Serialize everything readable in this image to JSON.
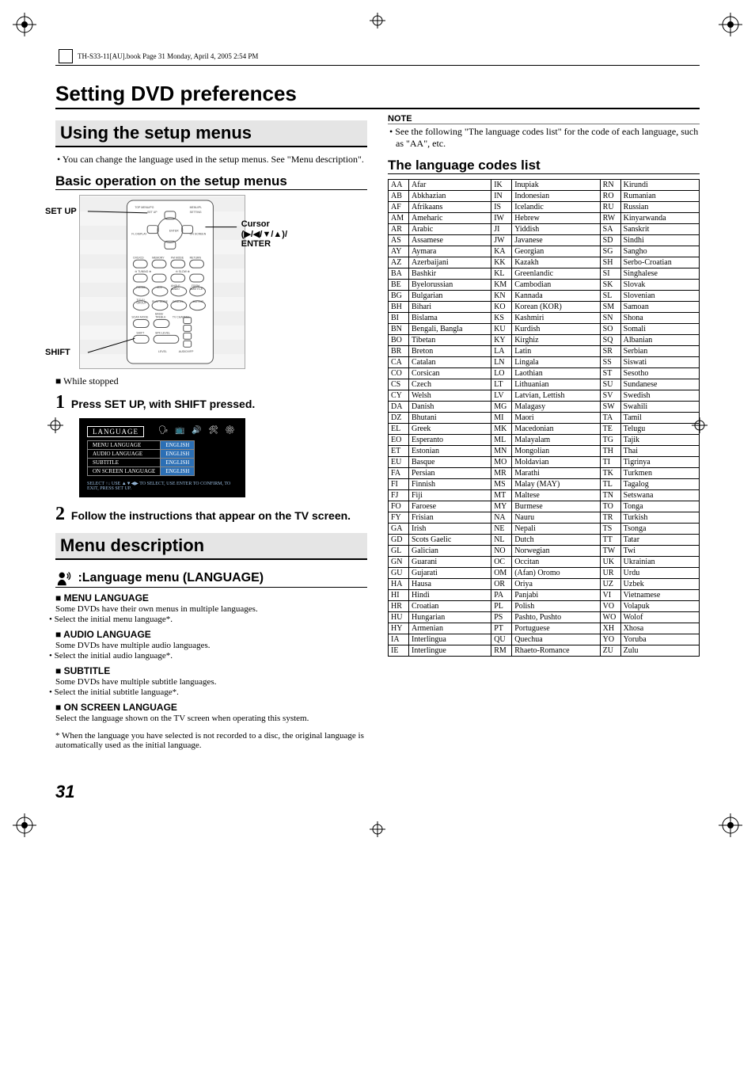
{
  "header_note": "TH-S33-11[AU].book  Page 31  Monday, April 4, 2005  2:54 PM",
  "doc_title": "Setting DVD preferences",
  "left": {
    "using_title": "Using the setup menus",
    "using_bullet": "You can change the language used in the setup menus. See \"Menu description\".",
    "basic_title": "Basic operation on the setup menus",
    "remote": {
      "setup": "SET UP",
      "shift": "SHIFT",
      "cursor": "Cursor",
      "cursor2": "(▶/◀/▼/▲)/",
      "enter": "ENTER",
      "btns": [
        "TOP MENU/PG",
        "MENU/PL",
        "SET UP",
        "SETTING",
        "FL DISPLAY",
        "ON SCREEN",
        "DVD/CD",
        "MEMORY",
        "FM MODE",
        "RETURN",
        "TUNING",
        "SLOW",
        "FM/AM",
        "AUX",
        "ANGLE AUDIO",
        "ZOOM SUBTITLE",
        "TITLE/ GROUP",
        "PLAY MODE",
        "CANCEL",
        "MUTING",
        "SCAN MODE",
        "BASS/ TREBLE",
        "TV CHANNEL",
        "SHIFT",
        "SPK-LEVEL",
        "LEVEL",
        "AUDIO/VFP"
      ]
    },
    "while_stopped": "While stopped",
    "step1": "Press SET UP, with SHIFT pressed.",
    "tv": {
      "title": "LANGUAGE",
      "rows": [
        [
          "MENU LANGUAGE",
          "ENGLISH"
        ],
        [
          "AUDIO LANGUAGE",
          "ENGLISH"
        ],
        [
          "SUBTITLE",
          "ENGLISH"
        ],
        [
          "ON SCREEN LANGUAGE",
          "ENGLISH"
        ]
      ],
      "hint": "SELECT ↑↓  USE ▲▼◀▶ TO SELECT, USE ENTER TO CONFIRM, TO EXIT, PRESS SET UP."
    },
    "step2": "Follow the instructions that appear on the TV screen.",
    "menu_desc_title": "Menu description",
    "lang_menu_title": ":Language menu (LANGUAGE)",
    "para": [
      {
        "label": "MENU LANGUAGE",
        "l1": "Some DVDs have their own menus in multiple languages.",
        "l2": "Select the initial menu language*."
      },
      {
        "label": "AUDIO LANGUAGE",
        "l1": "Some DVDs have multiple audio languages.",
        "l2": "Select the initial audio language*."
      },
      {
        "label": "SUBTITLE",
        "l1": "Some DVDs have multiple subtitle languages.",
        "l2": "Select the initial subtitle language*."
      },
      {
        "label": "ON SCREEN LANGUAGE",
        "l1": "Select the language shown on the TV screen when operating this system.",
        "l2": ""
      }
    ],
    "foot": "* When the language you have selected is not recorded to a disc, the original language is automatically used as the initial language.",
    "pagenum": "31"
  },
  "right": {
    "note_head": "NOTE",
    "note_body": "See the following \"The language codes list\" for the code of each language, such as \"AA\", etc.",
    "list_title": "The language codes list",
    "codes": [
      [
        "AA",
        "Afar",
        "IK",
        "Inupiak",
        "RN",
        "Kirundi"
      ],
      [
        "AB",
        "Abkhazian",
        "IN",
        "Indonesian",
        "RO",
        "Rumanian"
      ],
      [
        "AF",
        "Afrikaans",
        "IS",
        "Icelandic",
        "RU",
        "Russian"
      ],
      [
        "AM",
        "Ameharic",
        "IW",
        "Hebrew",
        "RW",
        "Kinyarwanda"
      ],
      [
        "AR",
        "Arabic",
        "JI",
        "Yiddish",
        "SA",
        "Sanskrit"
      ],
      [
        "AS",
        "Assamese",
        "JW",
        "Javanese",
        "SD",
        "Sindhi"
      ],
      [
        "AY",
        "Aymara",
        "KA",
        "Georgian",
        "SG",
        "Sangho"
      ],
      [
        "AZ",
        "Azerbaijani",
        "KK",
        "Kazakh",
        "SH",
        "Serbo-Croatian"
      ],
      [
        "BA",
        "Bashkir",
        "KL",
        "Greenlandic",
        "SI",
        "Singhalese"
      ],
      [
        "BE",
        "Byelorussian",
        "KM",
        "Cambodian",
        "SK",
        "Slovak"
      ],
      [
        "BG",
        "Bulgarian",
        "KN",
        "Kannada",
        "SL",
        "Slovenian"
      ],
      [
        "BH",
        "Bihari",
        "KO",
        "Korean (KOR)",
        "SM",
        "Samoan"
      ],
      [
        "BI",
        "Bislama",
        "KS",
        "Kashmiri",
        "SN",
        "Shona"
      ],
      [
        "BN",
        "Bengali, Bangla",
        "KU",
        "Kurdish",
        "SO",
        "Somali"
      ],
      [
        "BO",
        "Tibetan",
        "KY",
        "Kirghiz",
        "SQ",
        "Albanian"
      ],
      [
        "BR",
        "Breton",
        "LA",
        "Latin",
        "SR",
        "Serbian"
      ],
      [
        "CA",
        "Catalan",
        "LN",
        "Lingala",
        "SS",
        "Siswati"
      ],
      [
        "CO",
        "Corsican",
        "LO",
        "Laothian",
        "ST",
        "Sesotho"
      ],
      [
        "CS",
        "Czech",
        "LT",
        "Lithuanian",
        "SU",
        "Sundanese"
      ],
      [
        "CY",
        "Welsh",
        "LV",
        "Latvian, Lettish",
        "SV",
        "Swedish"
      ],
      [
        "DA",
        "Danish",
        "MG",
        "Malagasy",
        "SW",
        "Swahili"
      ],
      [
        "DZ",
        "Bhutani",
        "MI",
        "Maori",
        "TA",
        "Tamil"
      ],
      [
        "EL",
        "Greek",
        "MK",
        "Macedonian",
        "TE",
        "Telugu"
      ],
      [
        "EO",
        "Esperanto",
        "ML",
        "Malayalam",
        "TG",
        "Tajik"
      ],
      [
        "ET",
        "Estonian",
        "MN",
        "Mongolian",
        "TH",
        "Thai"
      ],
      [
        "EU",
        "Basque",
        "MO",
        "Moldavian",
        "TI",
        "Tigrinya"
      ],
      [
        "FA",
        "Persian",
        "MR",
        "Marathi",
        "TK",
        "Turkmen"
      ],
      [
        "FI",
        "Finnish",
        "MS",
        "Malay (MAY)",
        "TL",
        "Tagalog"
      ],
      [
        "FJ",
        "Fiji",
        "MT",
        "Maltese",
        "TN",
        "Setswana"
      ],
      [
        "FO",
        "Faroese",
        "MY",
        "Burmese",
        "TO",
        "Tonga"
      ],
      [
        "FY",
        "Frisian",
        "NA",
        "Nauru",
        "TR",
        "Turkish"
      ],
      [
        "GA",
        "Irish",
        "NE",
        "Nepali",
        "TS",
        "Tsonga"
      ],
      [
        "GD",
        "Scots Gaelic",
        "NL",
        "Dutch",
        "TT",
        "Tatar"
      ],
      [
        "GL",
        "Galician",
        "NO",
        "Norwegian",
        "TW",
        "Twi"
      ],
      [
        "GN",
        "Guarani",
        "OC",
        "Occitan",
        "UK",
        "Ukrainian"
      ],
      [
        "GU",
        "Gujarati",
        "OM",
        "(Afan) Oromo",
        "UR",
        "Urdu"
      ],
      [
        "HA",
        "Hausa",
        "OR",
        "Oriya",
        "UZ",
        "Uzbek"
      ],
      [
        "HI",
        "Hindi",
        "PA",
        "Panjabi",
        "VI",
        "Vietnamese"
      ],
      [
        "HR",
        "Croatian",
        "PL",
        "Polish",
        "VO",
        "Volapuk"
      ],
      [
        "HU",
        "Hungarian",
        "PS",
        "Pashto, Pushto",
        "WO",
        "Wolof"
      ],
      [
        "HY",
        "Armenian",
        "PT",
        "Portuguese",
        "XH",
        "Xhosa"
      ],
      [
        "IA",
        "Interlingua",
        "QU",
        "Quechua",
        "YO",
        "Yoruba"
      ],
      [
        "IE",
        "Interlingue",
        "RM",
        "Rhaeto-Romance",
        "ZU",
        "Zulu"
      ]
    ]
  }
}
